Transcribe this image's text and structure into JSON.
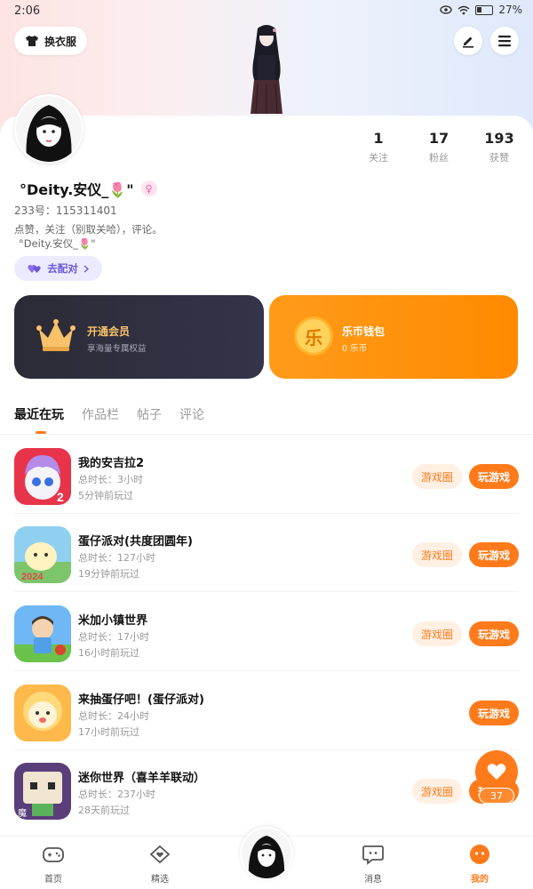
{
  "status": {
    "time": "2:06",
    "battery": "27%"
  },
  "header": {
    "outfit_label": "换衣服"
  },
  "stats": [
    {
      "num": "1",
      "label": "关注"
    },
    {
      "num": "17",
      "label": "粉丝"
    },
    {
      "num": "193",
      "label": "获赞"
    }
  ],
  "profile": {
    "name": "°Deity.安仪_🌷\"",
    "uid": "233号：115311401",
    "bio_line1": "点赞，关注（别取关哈），评论。",
    "bio_line2": "°Deity.安仪_🌷\"",
    "pair_label": "去配对"
  },
  "vip": {
    "title": "开通会员",
    "sub": "享海量专属权益"
  },
  "wallet": {
    "title": "乐币钱包",
    "sub": "0 乐币",
    "coin_char": "乐"
  },
  "tabs": [
    "最近在玩",
    "作品栏",
    "帖子",
    "评论"
  ],
  "games": [
    {
      "name": "我的安吉拉2",
      "duration": "总时长：3小时",
      "last": "5分钟前玩过",
      "circle_label": "游戏圈",
      "play_label": "玩游戏",
      "has_circle": true,
      "icon": "angela-icon"
    },
    {
      "name": "蛋仔派对(共度团圆年)",
      "duration": "总时长：127小时",
      "last": "19分钟前玩过",
      "circle_label": "游戏圈",
      "play_label": "玩游戏",
      "has_circle": true,
      "icon": "eggy-icon"
    },
    {
      "name": "米加小镇世界",
      "duration": "总时长：17小时",
      "last": "16小时前玩过",
      "circle_label": "游戏圈",
      "play_label": "玩游戏",
      "has_circle": true,
      "icon": "miga-icon"
    },
    {
      "name": "来抽蛋仔吧！(蛋仔派对)",
      "duration": "总时长：24小时",
      "last": "17小时前玩过",
      "circle_label": "",
      "play_label": "玩游戏",
      "has_circle": false,
      "icon": "eggy-draw-icon"
    },
    {
      "name": "迷你世界（喜羊羊联动）",
      "duration": "总时长：237小时",
      "last": "28天前玩过",
      "circle_label": "游戏圈",
      "play_label": "玩游戏",
      "has_circle": true,
      "icon": "mini-world-icon"
    }
  ],
  "float_like": {
    "count": "37"
  },
  "nav": [
    {
      "label": "首页",
      "icon": "gamepad-icon"
    },
    {
      "label": "精选",
      "icon": "heart-diamond-icon"
    },
    {
      "label": "",
      "icon": "avatar-center"
    },
    {
      "label": "消息",
      "icon": "chat-icon"
    },
    {
      "label": "我的",
      "icon": "face-icon"
    }
  ],
  "colors": {
    "accent": "#ff7a1a",
    "pair": "#6b58d8",
    "vip_gold": "#f7c26a"
  }
}
